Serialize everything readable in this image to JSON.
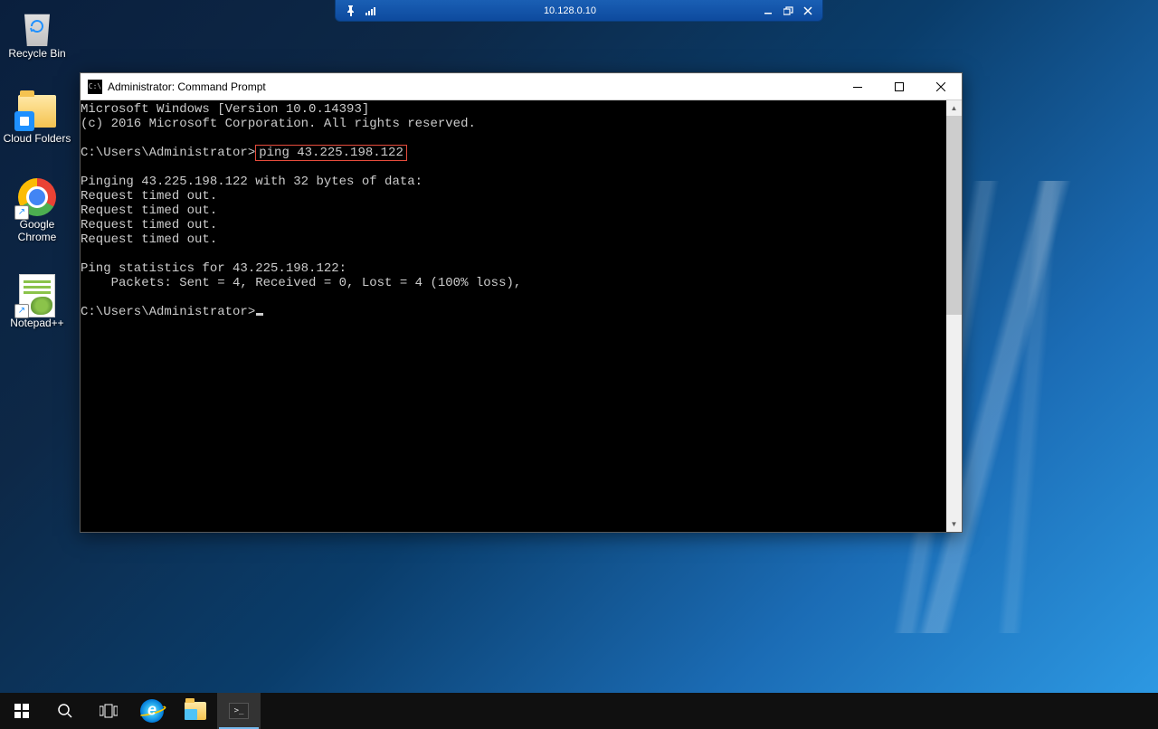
{
  "rdp": {
    "ip": "10.128.0.10"
  },
  "desktop_icons": {
    "recycle_bin": "Recycle Bin",
    "cloud_folders": "Cloud Folders",
    "chrome": "Google Chrome",
    "notepadpp": "Notepad++"
  },
  "cmd": {
    "title": "Administrator: Command Prompt",
    "line1": "Microsoft Windows [Version 10.0.14393]",
    "line2": "(c) 2016 Microsoft Corporation. All rights reserved.",
    "prompt1_pre": "C:\\Users\\Administrator>",
    "prompt1_cmd": "ping 43.225.198.122",
    "ping_header": "Pinging 43.225.198.122 with 32 bytes of data:",
    "timeout": "Request timed out.",
    "stats_header": "Ping statistics for 43.225.198.122:",
    "stats_line": "    Packets: Sent = 4, Received = 0, Lost = 4 (100% loss),",
    "prompt2": "C:\\Users\\Administrator>"
  }
}
